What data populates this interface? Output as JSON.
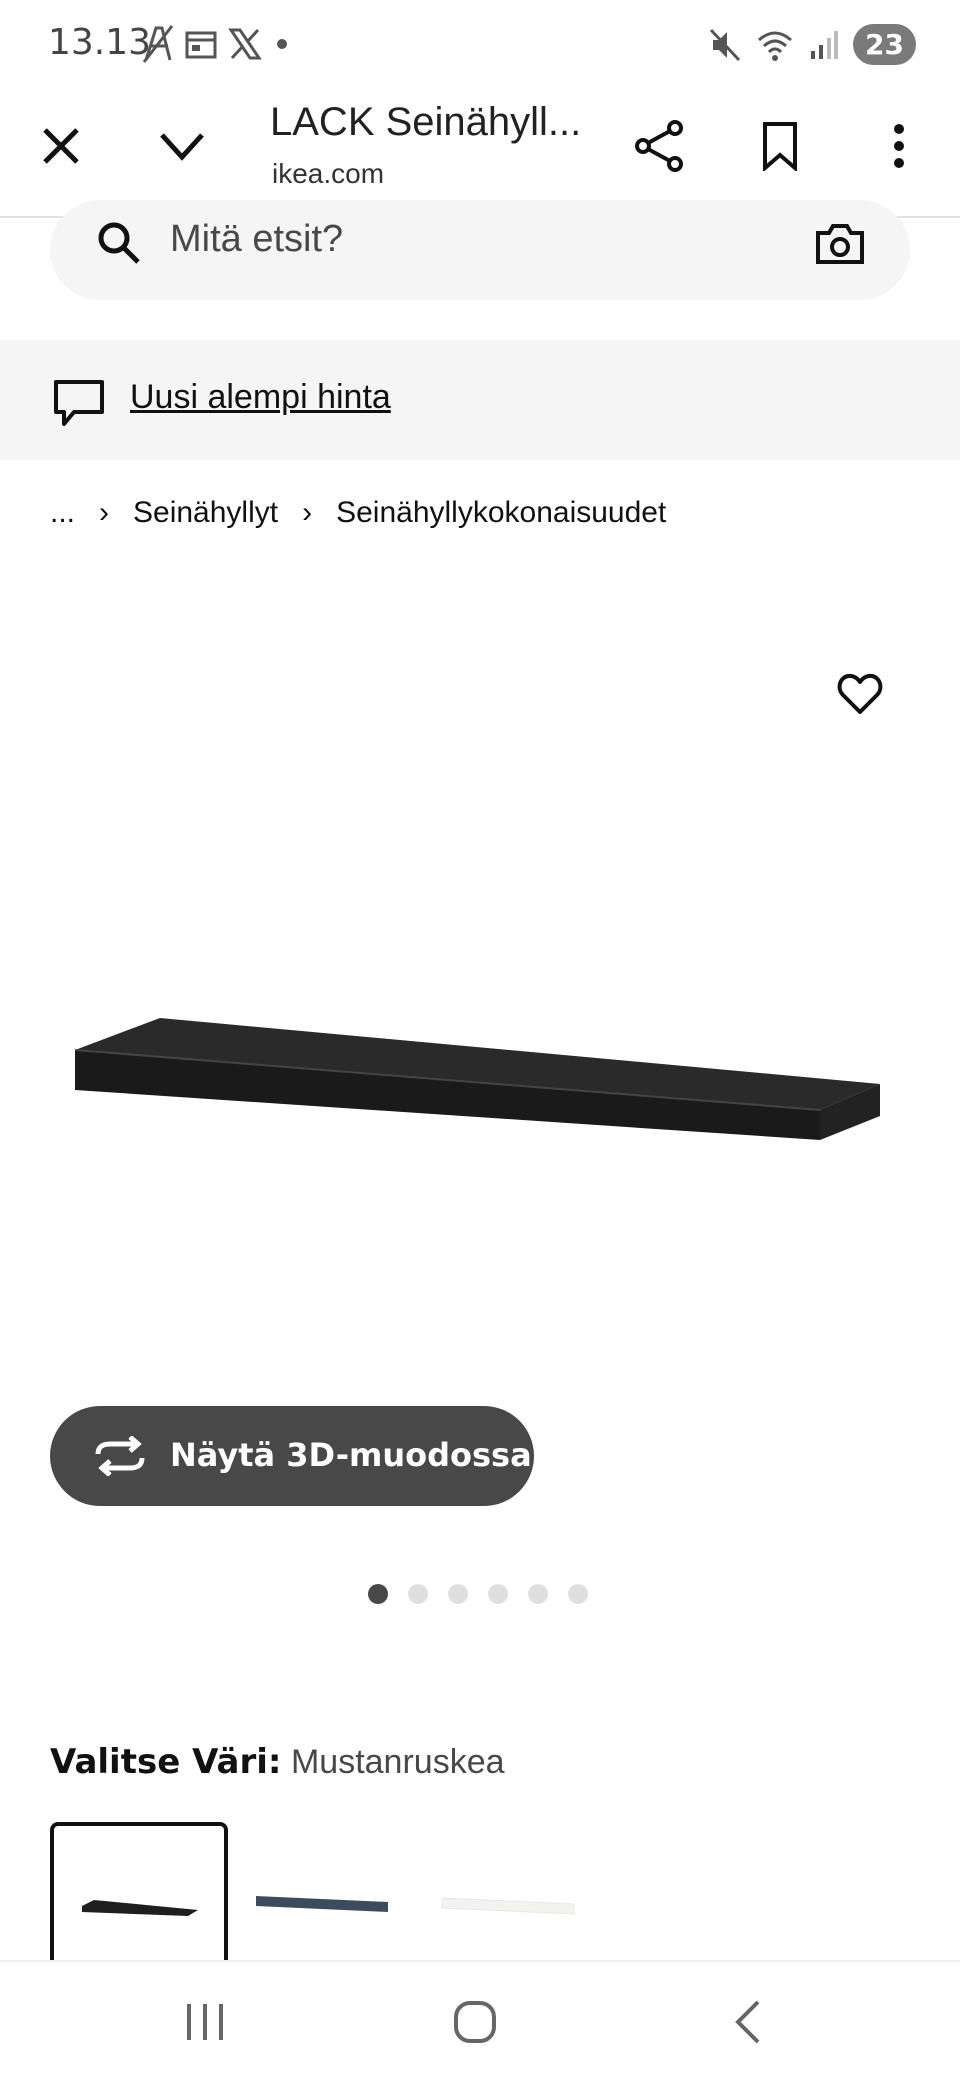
{
  "status_bar": {
    "time": "13.13",
    "notification_count": "23",
    "left_icons": [
      "accessibility-icon",
      "calendar-icon",
      "x-logo-icon",
      "dot-icon"
    ],
    "right_icons": [
      "mute-icon",
      "wifi-icon",
      "signal-icon"
    ]
  },
  "browser": {
    "title": "LACK Seinähyll...",
    "domain": "ikea.com"
  },
  "search": {
    "placeholder": "Mitä etsit?"
  },
  "banner": {
    "link_text": "Uusi alempi hinta"
  },
  "breadcrumb": {
    "items": [
      "...",
      "Seinähyllyt",
      "Seinähyllykokonaisuudet"
    ]
  },
  "product": {
    "view_3d_label": "Näytä 3D-muodossa",
    "image_count": 6,
    "active_image": 1,
    "color_label": "Valitse Väri:",
    "color_value": "Mustanruskea",
    "swatch_colors": [
      "#1e1e1e",
      "#3c4c5c",
      "#f2f2ee"
    ]
  },
  "colors": {
    "accent_dark": "#484848",
    "bg_light": "#f5f5f5"
  }
}
